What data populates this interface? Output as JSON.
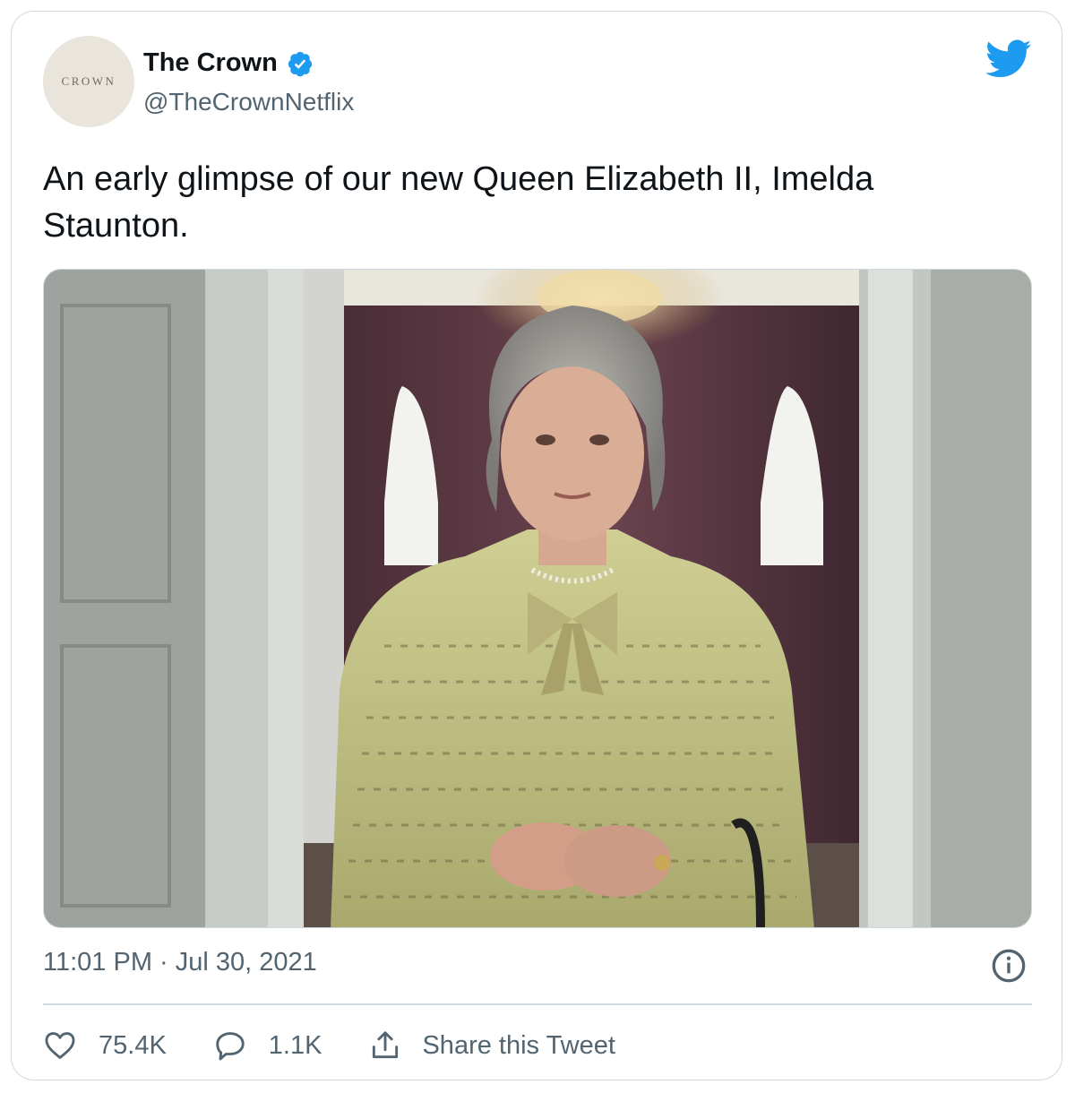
{
  "account": {
    "display_name": "The Crown",
    "handle": "@TheCrownNetflix",
    "avatar_text": "CROWN",
    "verified_icon": "verified-badge-icon",
    "verified_color": "#1d9bf0"
  },
  "brand": {
    "logo": "twitter-bird-icon",
    "color": "#1d9bf0"
  },
  "tweet": {
    "text": "An early glimpse of our new Queen Elizabeth II, Imelda Staunton.",
    "timestamp": "11:01 PM · Jul 30, 2021"
  },
  "actions": {
    "likes_icon": "heart-icon",
    "likes": "75.4K",
    "replies_icon": "reply-bubble-icon",
    "replies": "1.1K",
    "share_icon": "share-icon",
    "share_label": "Share this Tweet",
    "info_icon": "info-icon"
  }
}
